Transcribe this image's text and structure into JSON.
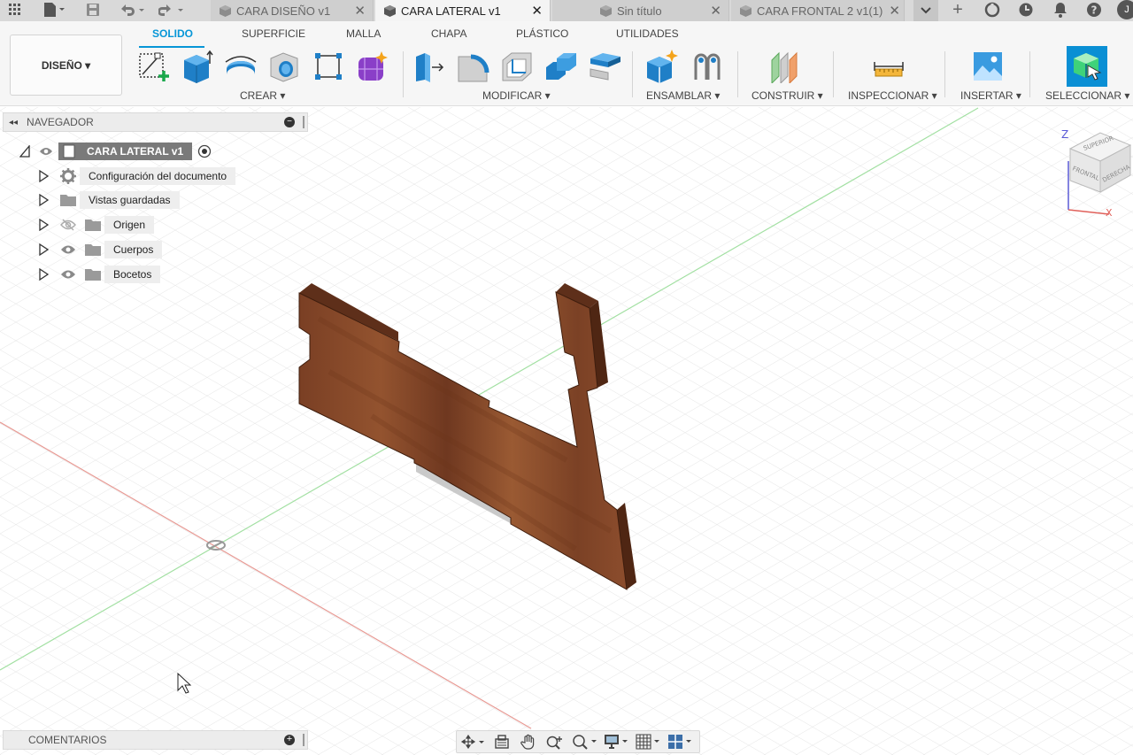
{
  "tabbar": {
    "tabs": [
      {
        "label": "CARA DISEÑO v1",
        "active": false
      },
      {
        "label": "CARA LATERAL v1",
        "active": true
      },
      {
        "label": "Sin título",
        "active": false
      },
      {
        "label": "CARA FRONTAL 2 v1(1)",
        "active": false
      }
    ],
    "user_initial": "J"
  },
  "ribbon": {
    "workspace": "DISEÑO ▾",
    "tabs": [
      "SOLIDO",
      "SUPERFICIE",
      "MALLA",
      "CHAPA",
      "PLÁSTICO",
      "UTILIDADES"
    ],
    "groups": [
      "CREAR ▾",
      "MODIFICAR ▾",
      "ENSAMBLAR ▾",
      "CONSTRUIR ▾",
      "INSPECCIONAR ▾",
      "INSERTAR ▾",
      "SELECCIONAR ▾"
    ]
  },
  "navigator": {
    "title": "NAVEGADOR",
    "root": "CARA LATERAL v1",
    "items": [
      {
        "label": "Configuración del documento",
        "icon": "gear-icon"
      },
      {
        "label": "Vistas guardadas",
        "icon": "folder-icon"
      },
      {
        "label": "Origen",
        "icon": "folder-icon",
        "visibility": "hidden"
      },
      {
        "label": "Cuerpos",
        "icon": "folder-icon",
        "visibility": "visible"
      },
      {
        "label": "Bocetos",
        "icon": "folder-icon",
        "visibility": "visible"
      }
    ]
  },
  "comments": {
    "title": "COMENTARIOS"
  },
  "viewcube": {
    "faces": [
      "SUPERIOR",
      "FRONTAL",
      "DERECHA"
    ],
    "axes": [
      "Z",
      "X"
    ]
  },
  "colors": {
    "accent": "#0696d7",
    "wood": "#8a4a2c",
    "x_axis": "#e07a72",
    "y_axis": "#7ed47e"
  }
}
